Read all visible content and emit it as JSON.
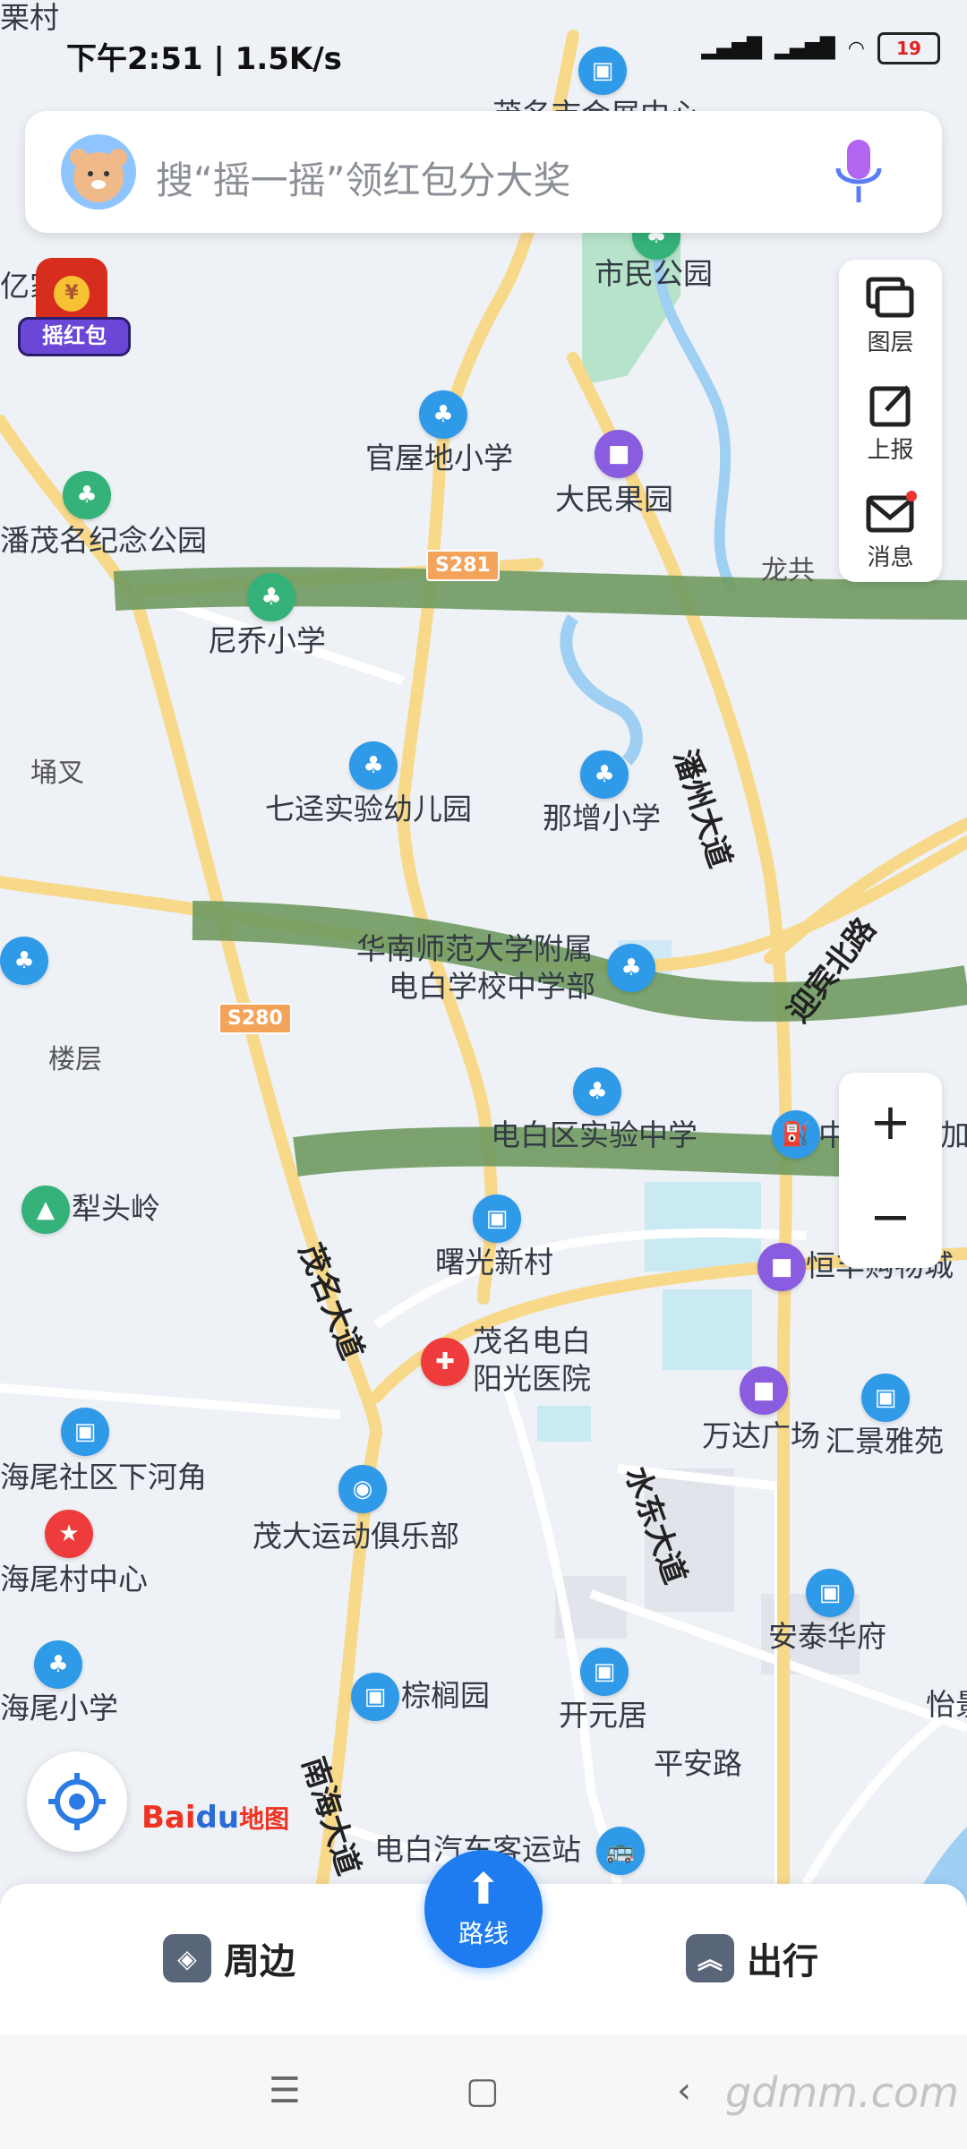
{
  "status_bar": {
    "time": "下午2:51 | 1.5K/s",
    "battery": "19"
  },
  "search": {
    "placeholder": "搜“摇一摇”领红包分大奖"
  },
  "red_packet": {
    "label": "摇红包"
  },
  "tools": [
    {
      "label": "图层",
      "icon": "layers-icon"
    },
    {
      "label": "上报",
      "icon": "report-icon"
    },
    {
      "label": "消息",
      "icon": "message-icon"
    }
  ],
  "zoom": {
    "in": "+",
    "out": "−"
  },
  "map": {
    "roads": [
      {
        "name": "潘州大道"
      },
      {
        "name": "迎宾北路"
      },
      {
        "name": "茂名大道"
      },
      {
        "name": "水东大道"
      },
      {
        "name": "南海大道"
      },
      {
        "name": "平安路"
      }
    ],
    "shields": [
      "S281",
      "S280"
    ],
    "pois": [
      {
        "name": "市民公园"
      },
      {
        "name": "官屋地小学"
      },
      {
        "name": "大民果园"
      },
      {
        "name": "潘茂名纪念公园"
      },
      {
        "name": "尼乔小学"
      },
      {
        "name": "龙共"
      },
      {
        "name": "埇叉"
      },
      {
        "name": "七迳实验幼儿园"
      },
      {
        "name": "那增小学"
      },
      {
        "name": "华南师范大学附属"
      },
      {
        "name": "电白学校中学部"
      },
      {
        "name": "楼层"
      },
      {
        "name": "电白区实验中学"
      },
      {
        "name": "犁头岭"
      },
      {
        "name": "曙光新村"
      },
      {
        "name": "恒丰购物城"
      },
      {
        "name": "茂名电白"
      },
      {
        "name": "阳光医院"
      },
      {
        "name": "万达广场"
      },
      {
        "name": "汇景雅苑"
      },
      {
        "name": "海尾社区下河角"
      },
      {
        "name": "茂大运动俱乐部"
      },
      {
        "name": "海尾村中心"
      },
      {
        "name": "安泰华府"
      },
      {
        "name": "海尾小学"
      },
      {
        "name": "棕榈园"
      },
      {
        "name": "开元居"
      },
      {
        "name": "怡景"
      },
      {
        "name": "电白汽车客运站"
      },
      {
        "name": "茂名市会展中心"
      },
      {
        "name": "亿家居"
      },
      {
        "name": "栗村"
      },
      {
        "name": "中"
      },
      {
        "name": "加"
      }
    ]
  },
  "baidu_logo": {
    "b1": "Bai",
    "b2": "du",
    "b3": "地图"
  },
  "bottom": {
    "around": "周边",
    "route": "路线",
    "travel": "出行"
  },
  "watermark": "gdmm.com"
}
